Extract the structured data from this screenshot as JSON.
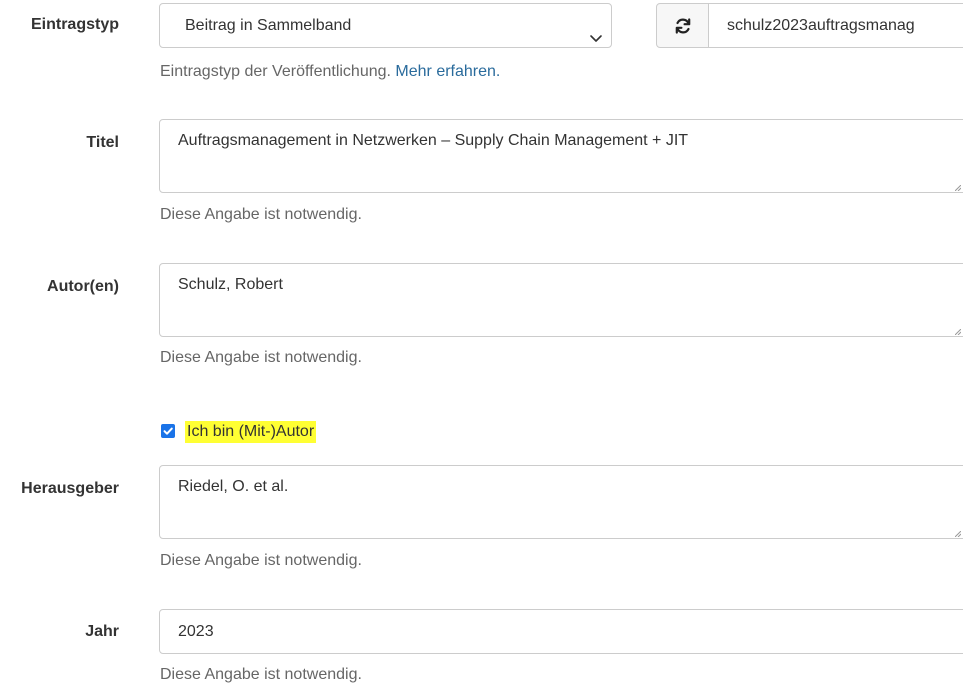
{
  "entry_type": {
    "label": "Eintragstyp",
    "value": "Beitrag in Sammelband",
    "help_text": "Eintragstyp der Veröffentlichung.",
    "help_link": "Mehr erfahren."
  },
  "bibtex_key": {
    "value": "schulz2023auftragsmanag"
  },
  "title": {
    "label": "Titel",
    "value": "Auftragsmanagement in Netzwerken – Supply Chain Management + JIT",
    "help": "Diese Angabe ist notwendig."
  },
  "authors": {
    "label": "Autor(en)",
    "value": "Schulz, Robert",
    "help": "Diese Angabe ist notwendig."
  },
  "is_author": {
    "label": "Ich bin (Mit-)Autor",
    "checked": true,
    "highlight_color": "#ffff33"
  },
  "editors": {
    "label": "Herausgeber",
    "value": "Riedel, O. et al.",
    "help": "Diese Angabe ist notwendig."
  },
  "year": {
    "label": "Jahr",
    "value": "2023",
    "help": "Diese Angabe ist notwendig."
  },
  "icons": {
    "refresh": "refresh-icon",
    "chevron": "chevron-down-icon",
    "resize": "resize-grip-icon",
    "check": "checkbox-check-icon"
  },
  "colors": {
    "link": "#2a6b9c",
    "checkbox": "#1a73e8",
    "help_text": "#666666"
  }
}
